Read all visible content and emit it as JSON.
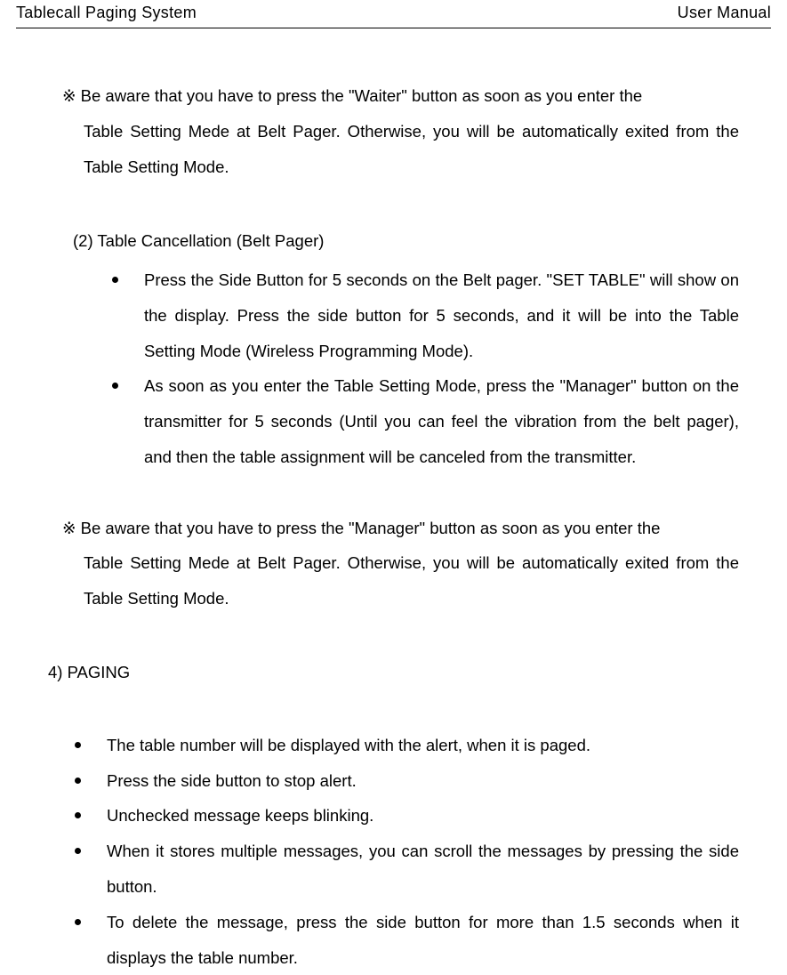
{
  "header": {
    "left": "Tablecall Paging System",
    "right": "User Manual"
  },
  "note1": {
    "line1": "※ Be aware that you have to press the \"Waiter\" button as soon as you enter the",
    "rest": "Table Setting Mede at Belt Pager. Otherwise, you will be automatically exited from the Table Setting Mode."
  },
  "subsection2": {
    "title": "(2)  Table Cancellation (Belt Pager)",
    "bullets": [
      "Press the Side Button for 5 seconds on the Belt pager. \"SET TABLE\" will show on the display. Press the side button for 5 seconds, and it will be into the Table Setting Mode (Wireless Programming Mode).",
      "As soon as you enter the Table Setting Mode, press the \"Manager\" button on the transmitter for 5 seconds (Until you can feel the vibration from the belt pager), and then the table assignment will be canceled from the transmitter."
    ]
  },
  "note2": {
    "line1": "※ Be aware that you have to press the \"Manager\" button as soon as you enter the",
    "rest": "Table Setting Mede at Belt Pager. Otherwise, you will be automatically exited from the Table Setting Mode."
  },
  "section4": {
    "heading": "4) PAGING",
    "bullets": [
      "The table number will be displayed with the alert, when it is paged.",
      "Press the side button to stop alert.",
      "Unchecked message keeps blinking.",
      "When it stores multiple messages, you can scroll the messages by pressing the side button.",
      "To delete the message, press the side button for more than 1.5 seconds when it displays the table number."
    ]
  }
}
